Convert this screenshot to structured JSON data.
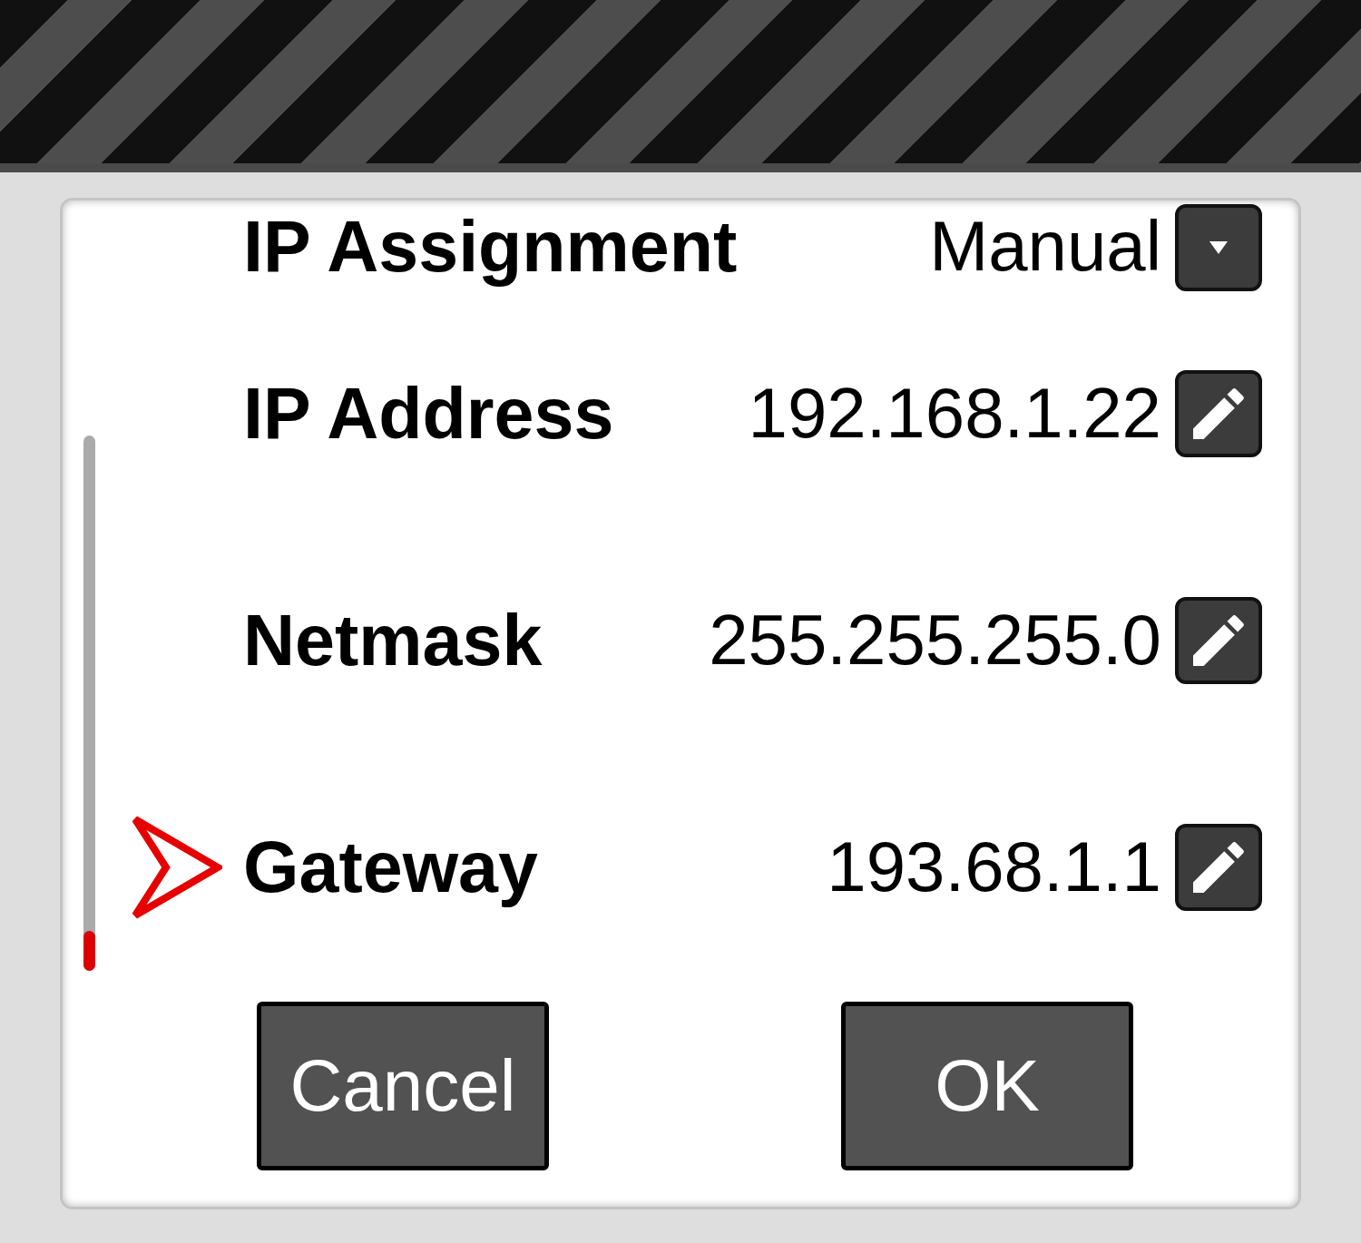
{
  "settings": [
    {
      "kind": "dropdown",
      "label": "IP Assignment",
      "value": "Manual",
      "selected": false
    },
    {
      "kind": "editable",
      "label": "IP Address",
      "value": "192.168.1.22",
      "selected": false
    },
    {
      "kind": "editable",
      "label": "Netmask",
      "value": "255.255.255.0",
      "selected": false
    },
    {
      "kind": "editable",
      "label": "Gateway",
      "value": "193.68.1.1",
      "selected": true
    }
  ],
  "buttons": [
    {
      "label": "Cancel"
    },
    {
      "label": "OK"
    }
  ]
}
